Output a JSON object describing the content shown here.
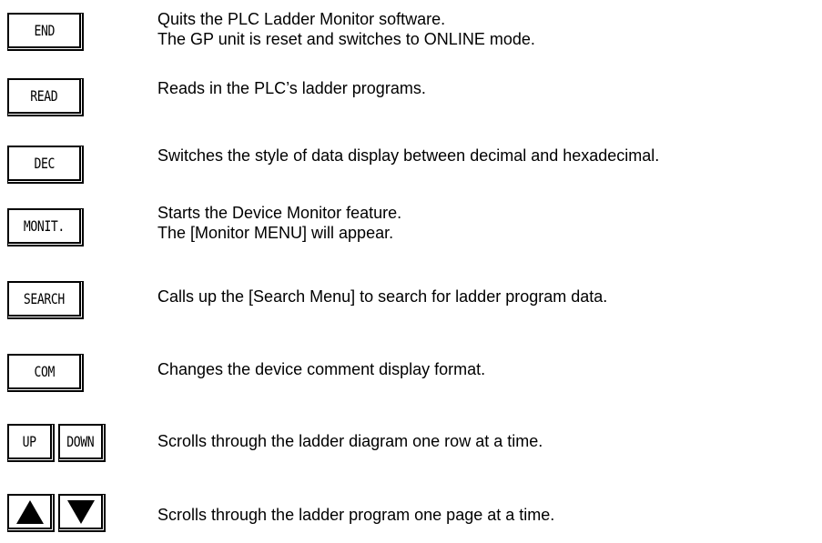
{
  "items": [
    {
      "key_label": "END",
      "lines": [
        "Quits the PLC Ladder Monitor software.",
        "The GP unit is reset and switches to ONLINE mode."
      ]
    },
    {
      "key_label": "READ",
      "lines": [
        "Reads in the PLC’s ladder programs."
      ]
    },
    {
      "key_label": "DEC",
      "lines": [
        "Switches the style of data display between decimal and hexadecimal."
      ]
    },
    {
      "key_label": "MONIT.",
      "lines": [
        "Starts the Device Monitor feature.",
        "The [Monitor MENU] will appear."
      ]
    },
    {
      "key_label": "SEARCH",
      "lines": [
        "Calls up the [Search Menu] to search for ladder program data."
      ]
    },
    {
      "key_label": "COM",
      "lines": [
        "Changes the device comment display format."
      ]
    },
    {
      "key_labels": [
        "UP",
        "DOWN"
      ],
      "lines": [
        "Scrolls through the ladder diagram one row at a time."
      ]
    },
    {
      "key_icons": [
        "up-triangle-icon",
        "down-triangle-icon"
      ],
      "lines": [
        "Scrolls through the ladder program one page at a time."
      ]
    }
  ]
}
